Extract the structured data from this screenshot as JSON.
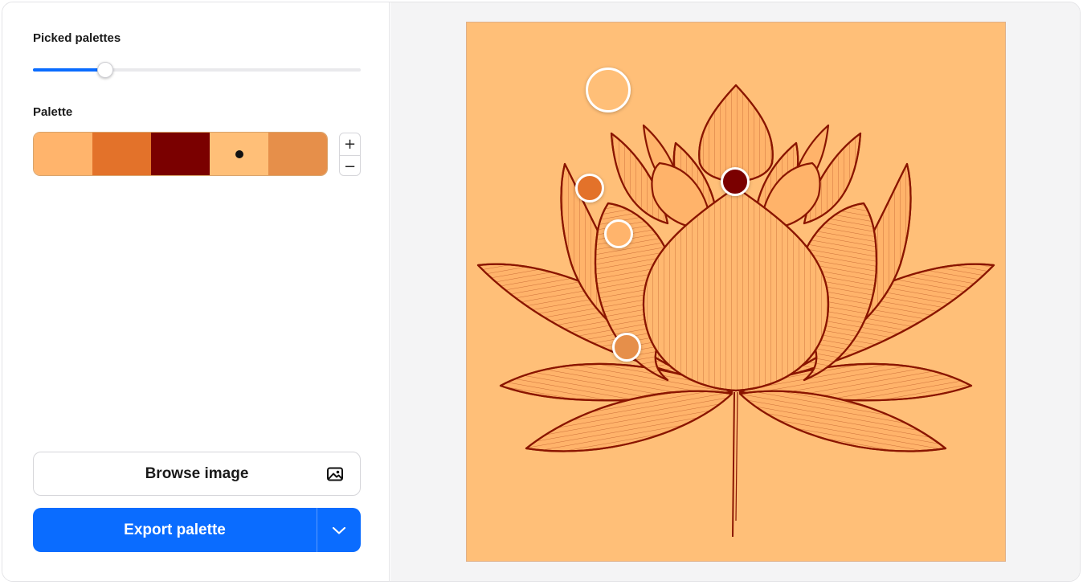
{
  "sidebar": {
    "picked_label": "Picked palettes",
    "picked_value_fraction": 0.22,
    "palette_label": "Palette",
    "swatches": [
      "#ffb46c",
      "#e3722a",
      "#7a0000",
      "#ffbf78",
      "#e68f4a"
    ],
    "selected_swatch_index": 3,
    "stepper_plus": "+",
    "stepper_minus": "−",
    "browse_label": "Browse image",
    "browse_icon": "image-icon",
    "export_label": "Export palette",
    "export_menu_icon": "chevron-down-icon"
  },
  "image": {
    "background_color": "#ffbf78",
    "line_color": "#8a1500",
    "subject": "lotus-flower"
  },
  "accent_color": "#0a6cff"
}
